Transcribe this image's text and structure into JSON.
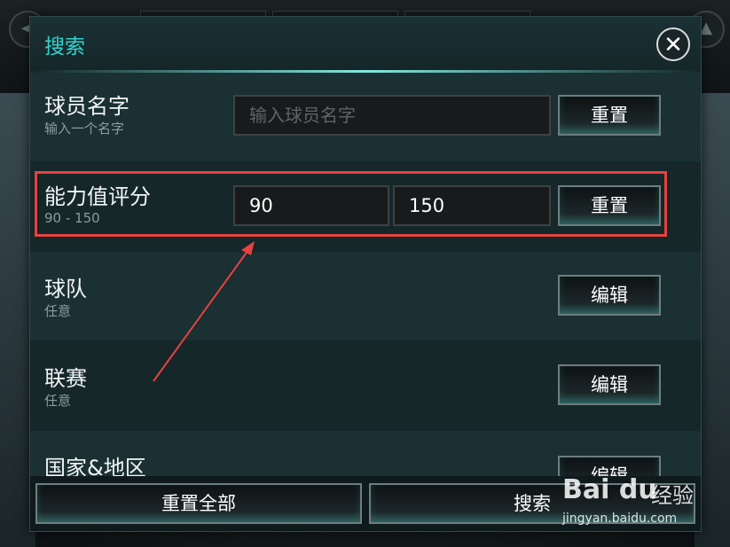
{
  "dialog": {
    "title": "搜索",
    "close_glyph": "✕"
  },
  "filters": {
    "player_name": {
      "title": "球员名字",
      "subtitle": "输入一个名字",
      "placeholder": "输入球员名字",
      "button": "重置"
    },
    "rating": {
      "title": "能力值评分",
      "subtitle": "90 - 150",
      "min_value": "90",
      "max_value": "150",
      "button": "重置"
    },
    "team": {
      "title": "球队",
      "subtitle": "任意",
      "button": "编辑"
    },
    "league": {
      "title": "联赛",
      "subtitle": "任意",
      "button": "编辑"
    },
    "nation": {
      "title": "国家&地区",
      "button": "编辑"
    }
  },
  "footer": {
    "reset_all": "重置全部",
    "search": "搜索"
  },
  "watermark": {
    "logo": "Bai du",
    "product": "经验",
    "url": "jingyan.baidu.com"
  },
  "colors": {
    "accent": "#34d3cf",
    "annotation": "#e8413f"
  }
}
